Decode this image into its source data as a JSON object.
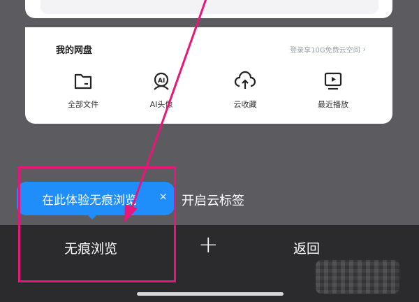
{
  "netdisk": {
    "title": "我的网盘",
    "promo_link": "登录享10G免费云空间",
    "promo_chevron": "›",
    "apps": [
      {
        "label": "全部文件",
        "icon": "folder-icon"
      },
      {
        "label": "AI头像",
        "icon": "ai-avatar-icon"
      },
      {
        "label": "云收藏",
        "icon": "cloud-upload-icon"
      },
      {
        "label": "最近播放",
        "icon": "play-screen-icon"
      }
    ]
  },
  "tooltip": {
    "text": "在此体验无痕浏览",
    "close": "×"
  },
  "cloud_tab": {
    "label": "开启云标签"
  },
  "bottom_bar": {
    "incognito_label": "无痕浏览",
    "add_label": "+",
    "back_label": "返回"
  },
  "colors": {
    "tooltip_bg": "#1f8efa",
    "annotation_pink": "#e8157a",
    "bar_bg": "#2b2b2e"
  }
}
